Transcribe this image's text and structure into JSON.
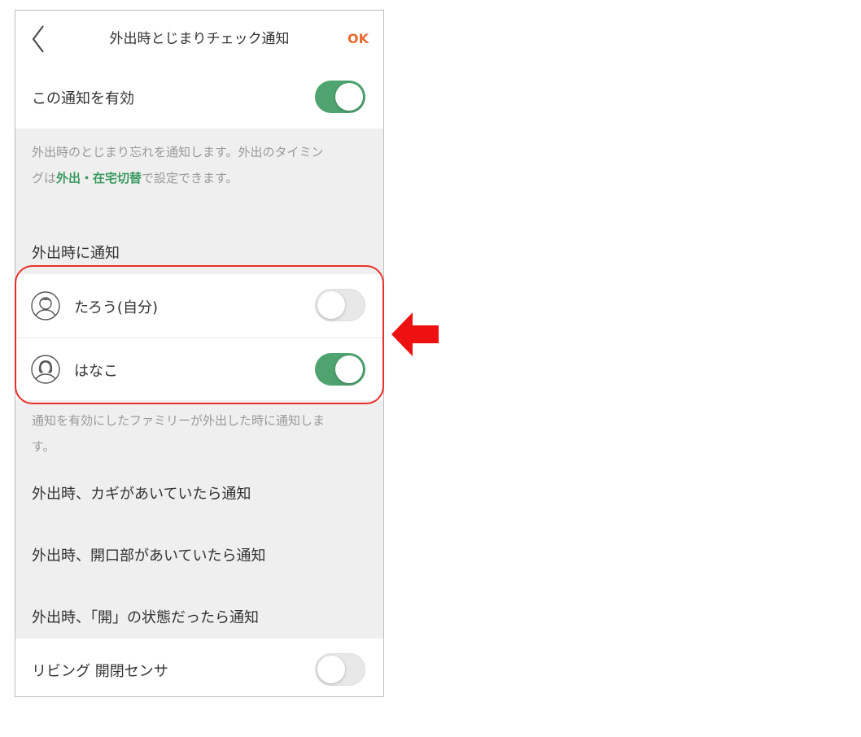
{
  "nav": {
    "title": "外出時とじまりチェック通知",
    "ok_label": "OK"
  },
  "enable": {
    "label": "この通知を有効",
    "on": true
  },
  "description": {
    "text1": "外出時のとじまり忘れを通知します。外出のタイミン",
    "text2_pre": "グは",
    "text2_link": "外出・在宅切替",
    "text2_post": "で設定できます。"
  },
  "notify_section": {
    "title": "外出時に通知"
  },
  "members": [
    {
      "name": "たろう(自分)",
      "on": false,
      "avatar": "male-avatar-icon"
    },
    {
      "name": "はなこ",
      "on": true,
      "avatar": "female-avatar-icon"
    }
  ],
  "members_note": {
    "line1": "通知を有効にしたファミリーが外出した時に通知しま",
    "line2": "す。"
  },
  "sections": {
    "key_open": "外出時、カギがあいていたら通知",
    "opening_open": "外出時、開口部があいていたら通知",
    "state_open": "外出時、「開」の状態だったら通知"
  },
  "sensor": {
    "label": "リビング 開閉センサ",
    "on": false
  },
  "colors": {
    "accent_green": "#4ea36f",
    "ok_orange": "#e8692e",
    "highlight_red": "#e8302a"
  }
}
